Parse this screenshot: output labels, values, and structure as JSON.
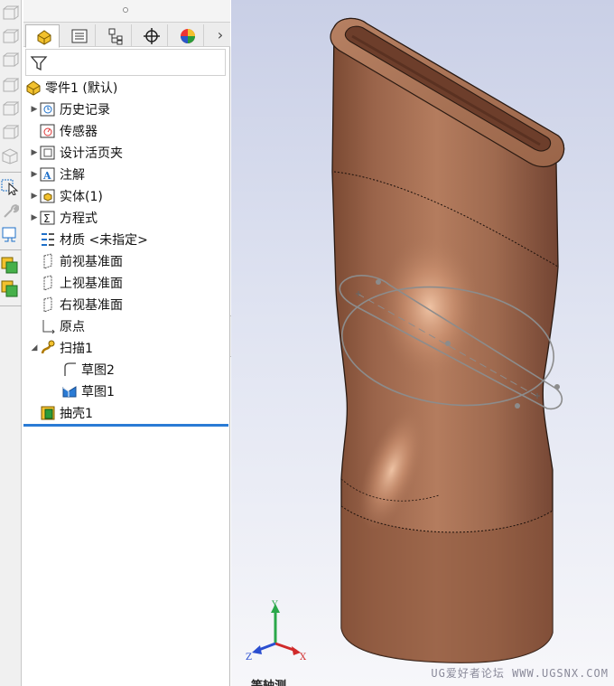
{
  "feature_tree": {
    "tabs": [
      "feature-manager",
      "property-manager",
      "configuration-manager",
      "dimxpert-manager",
      "display-manager"
    ],
    "root": {
      "label": "零件1 (默认)"
    },
    "items": [
      {
        "label": "历史记录",
        "icon": "history-icon",
        "expand": true
      },
      {
        "label": "传感器",
        "icon": "sensor-icon",
        "expand": false
      },
      {
        "label": "设计活页夹",
        "icon": "design-binder-icon",
        "expand": true
      },
      {
        "label": "注解",
        "icon": "annotations-icon",
        "expand": true
      },
      {
        "label": "实体(1)",
        "icon": "solid-bodies-icon",
        "expand": true
      },
      {
        "label": "方程式",
        "icon": "equations-icon",
        "expand": true
      },
      {
        "label": "材质 <未指定>",
        "icon": "material-icon",
        "expand": false
      },
      {
        "label": "前视基准面",
        "icon": "plane-icon",
        "expand": false
      },
      {
        "label": "上视基准面",
        "icon": "plane-icon",
        "expand": false
      },
      {
        "label": "右视基准面",
        "icon": "plane-icon",
        "expand": false
      },
      {
        "label": "原点",
        "icon": "origin-icon",
        "expand": false
      },
      {
        "label": "扫描1",
        "icon": "sweep-icon",
        "expand": "open"
      },
      {
        "label": "草图2",
        "icon": "sketch-icon",
        "expand": false
      },
      {
        "label": "草图1",
        "icon": "sketch-icon",
        "expand": false
      },
      {
        "label": "抽壳1",
        "icon": "shell-icon",
        "expand": false
      }
    ]
  },
  "viewport": {
    "watermark": "UG爱好者论坛 WWW.UGSNX.COM",
    "view_label": "等轴测",
    "triad": {
      "x": "X",
      "y": "Y",
      "z": "Z"
    }
  },
  "colors": {
    "accent_blue": "#2a7bd5",
    "model_copper": "#a0684c",
    "sketch_gray": "#8c8c8c"
  }
}
